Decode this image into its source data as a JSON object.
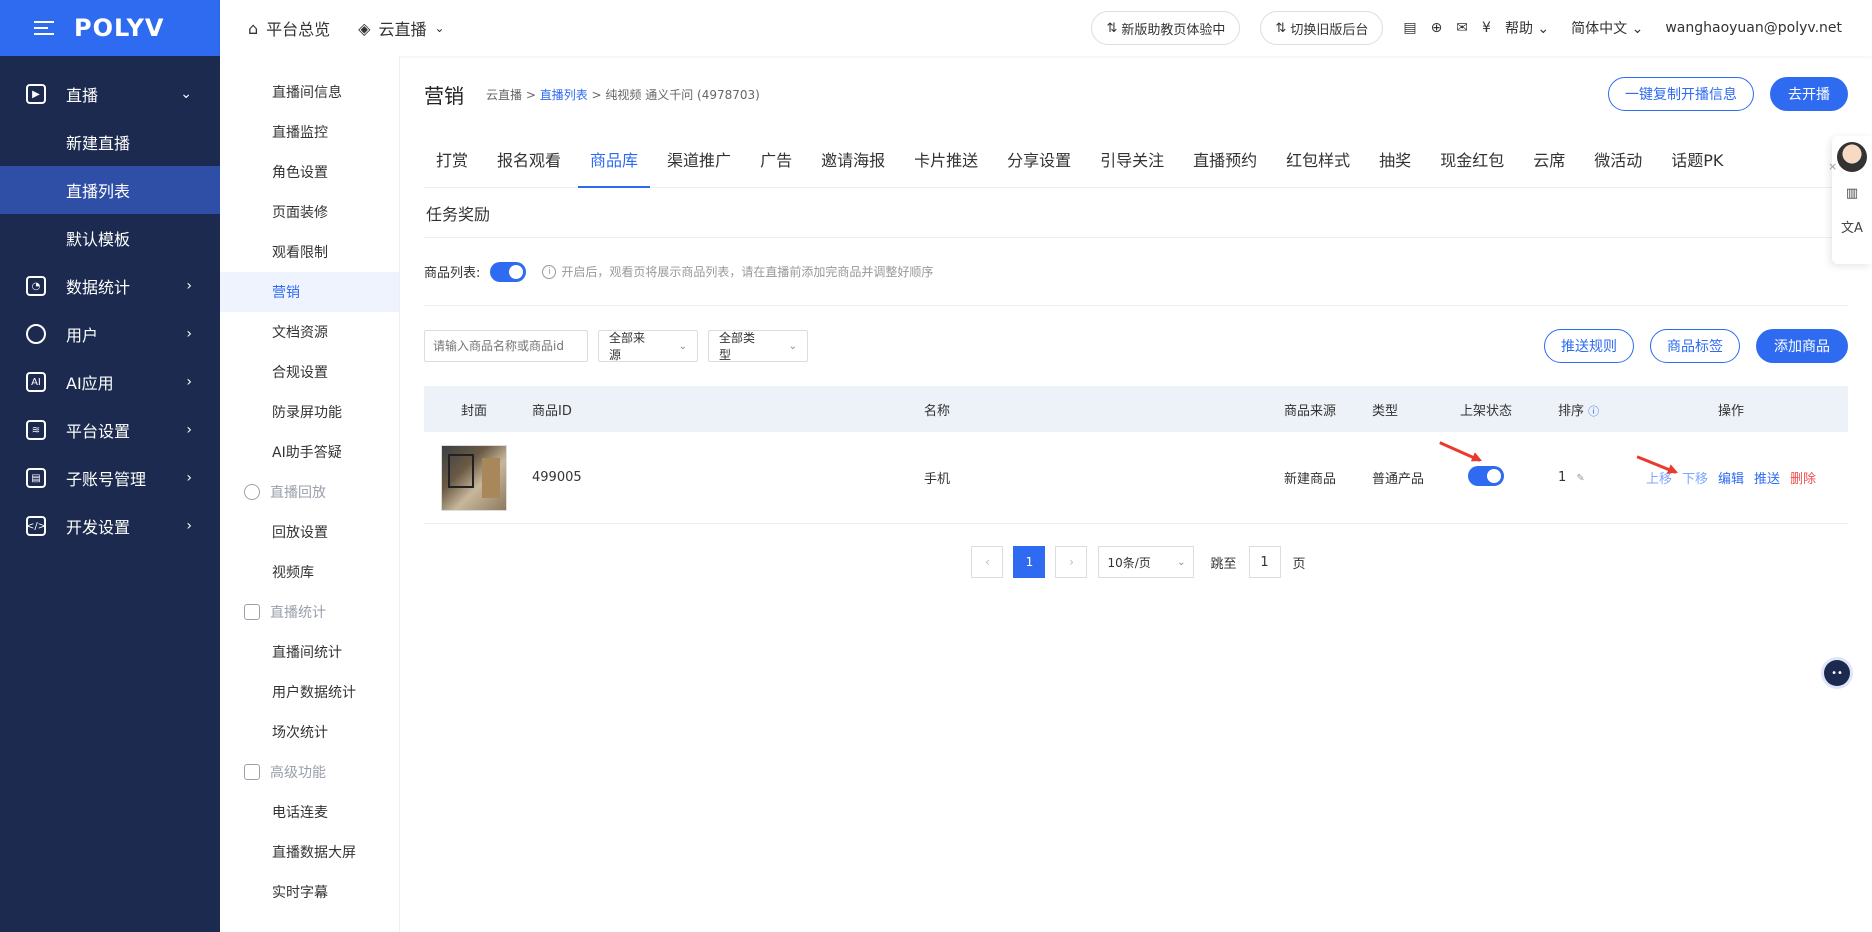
{
  "brand": {
    "logo": "POLYV",
    "color": "#2f6bf0"
  },
  "topbar": {
    "home": "平台总览",
    "product": "云直播",
    "new_ui": "新版助教页体验中",
    "old_ui": "切换旧版后台",
    "help": "帮助",
    "lang": "简体中文",
    "user": "wanghaoyuan@polyv.net"
  },
  "sidebar": {
    "live": "直播",
    "new_live": "新建直播",
    "live_list": "直播列表",
    "default_tpl": "默认模板",
    "stats": "数据统计",
    "users": "用户",
    "ai": "AI应用",
    "platform": "平台设置",
    "subaccount": "子账号管理",
    "dev": "开发设置"
  },
  "sub_sidebar": {
    "items": [
      "直播间信息",
      "直播监控",
      "角色设置",
      "页面装修",
      "观看限制",
      "营销",
      "文档资源",
      "合规设置",
      "防录屏功能",
      "AI助手答疑"
    ],
    "group_replay": "直播回放",
    "replay_items": [
      "回放设置",
      "视频库"
    ],
    "group_stats": "直播统计",
    "stats_items": [
      "直播间统计",
      "用户数据统计",
      "场次统计"
    ],
    "group_adv": "高级功能",
    "adv_items": [
      "电话连麦",
      "直播数据大屏",
      "实时字幕"
    ]
  },
  "page": {
    "title": "营销",
    "crumb_1": "云直播",
    "crumb_2": "直播列表",
    "crumb_3": "纯视频 通义千问 (4978703)",
    "copy_btn": "一键复制开播信息",
    "go_live_btn": "去开播"
  },
  "tabs": [
    "打赏",
    "报名观看",
    "商品库",
    "渠道推广",
    "广告",
    "邀请海报",
    "卡片推送",
    "分享设置",
    "引导关注",
    "直播预约",
    "红包样式",
    "抽奖",
    "现金红包",
    "云席",
    "微活动",
    "话题PK"
  ],
  "tabs2": [
    "任务奖励"
  ],
  "goods": {
    "switch_label": "商品列表:",
    "hint": "开启后，观看页将展示商品列表，请在直播前添加完商品并调整好顺序",
    "search_placeholder": "请输入商品名称或商品id",
    "source_select": "全部来源",
    "type_select": "全部类型",
    "push_rule": "推送规则",
    "tag_btn": "商品标签",
    "add_btn": "添加商品"
  },
  "table": {
    "headers": [
      "封面",
      "商品ID",
      "名称",
      "商品来源",
      "类型",
      "上架状态",
      "排序",
      "操作"
    ],
    "row": {
      "id": "499005",
      "name": "手机",
      "source": "新建商品",
      "type": "普通产品",
      "order": "1",
      "ops": [
        "上移",
        "下移",
        "编辑",
        "推送",
        "删除"
      ]
    }
  },
  "pager": {
    "current": "1",
    "size": "10条/页",
    "jump": "跳至",
    "jump_value": "1",
    "page_unit": "页"
  }
}
